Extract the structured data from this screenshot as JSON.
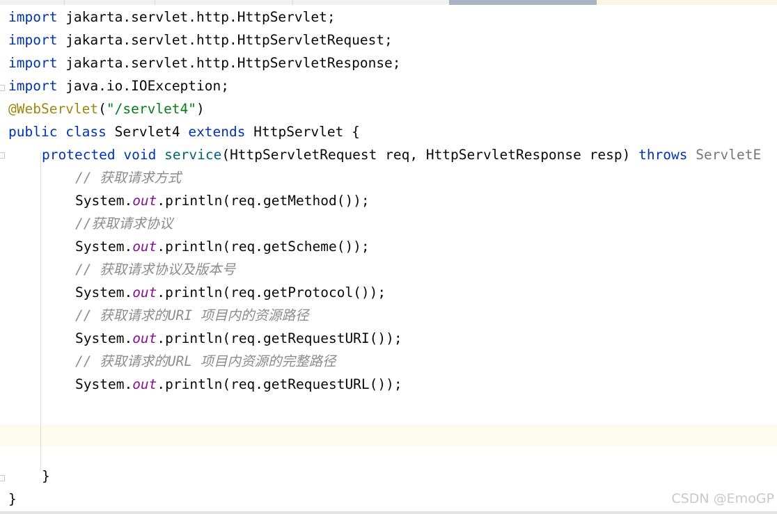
{
  "code": {
    "l1": {
      "kw": "import",
      "rest": " jakarta.servlet.http.HttpServlet;"
    },
    "l2": {
      "kw": "import",
      "rest": " jakarta.servlet.http.HttpServletRequest;"
    },
    "l3": {
      "kw": "import",
      "rest": " jakarta.servlet.http.HttpServletResponse;"
    },
    "l4": {
      "kw": "import",
      "rest": " java.io.IOException;"
    },
    "l5": {
      "ann": "@WebServlet",
      "p1": "(",
      "str": "\"/servlet4\"",
      "p2": ")"
    },
    "l6": {
      "kw1": "public",
      "kw2": "class",
      "name": "Servlet4",
      "kw3": "extends",
      "rest": " HttpServlet {"
    },
    "l7": {
      "kw1": "protected",
      "kw2": "void",
      "fn": "service",
      "params": "(HttpServletRequest req, HttpServletResponse resp) ",
      "kw3": "throws",
      "exc": " ServletE"
    },
    "l8": {
      "cmt": "// 获取请求方式"
    },
    "l9": {
      "pre": "System.",
      "fld": "out",
      "post": ".println(req.getMethod());"
    },
    "l10": {
      "cmt": "//获取请求协议"
    },
    "l11": {
      "pre": "System.",
      "fld": "out",
      "post": ".println(req.getScheme());"
    },
    "l12": {
      "cmt": "// 获取请求协议及版本号"
    },
    "l13": {
      "pre": "System.",
      "fld": "out",
      "post": ".println(req.getProtocol());"
    },
    "l14": {
      "cmt": "// 获取请求的URI 项目内的资源路径"
    },
    "l15": {
      "pre": "System.",
      "fld": "out",
      "post": ".println(req.getRequestURI());"
    },
    "l16": {
      "cmt": "// 获取请求的URL 项目内资源的完整路径"
    },
    "l17": {
      "pre": "System.",
      "fld": "out",
      "post": ".println(req.getRequestURL());"
    },
    "l21": {
      "text": "}"
    },
    "l22": {
      "text": "}"
    }
  },
  "watermark": "CSDN @EmoGP"
}
